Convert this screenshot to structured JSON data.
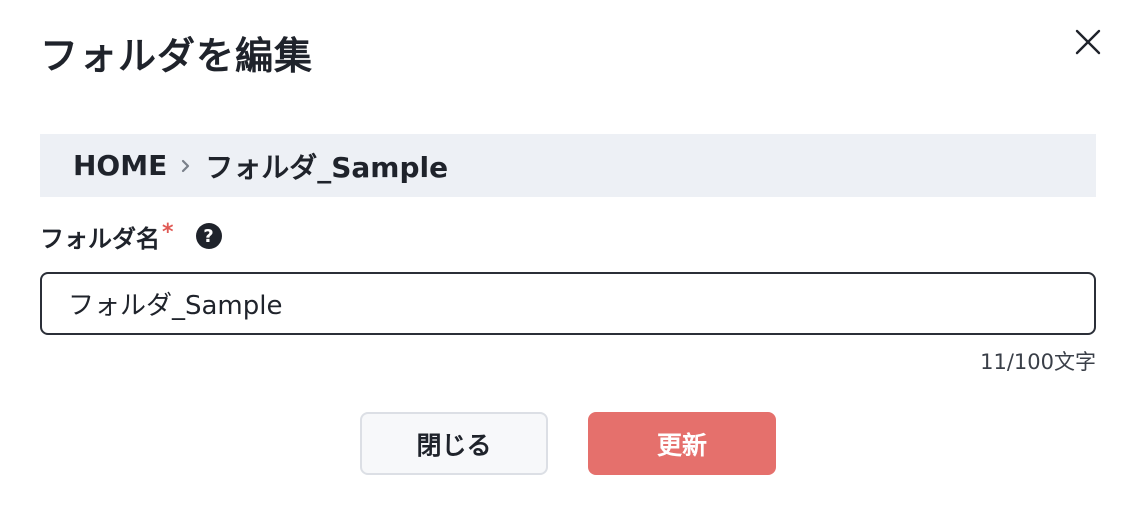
{
  "dialog": {
    "title": "フォルダを編集",
    "close_icon": "close-icon"
  },
  "breadcrumb": {
    "items": [
      "HOME",
      "フォルダ_Sample"
    ],
    "separator_icon": "chevron-right-icon"
  },
  "field": {
    "label": "フォルダ名",
    "required_mark": "*",
    "help_icon": "?",
    "value": "フォルダ_Sample",
    "char_count": "11/100文字"
  },
  "buttons": {
    "close_label": "閉じる",
    "update_label": "更新"
  },
  "colors": {
    "accent": "#e5706c",
    "required": "#e05a55",
    "breadcrumb_bg": "#edf0f5",
    "text": "#1f232b"
  }
}
